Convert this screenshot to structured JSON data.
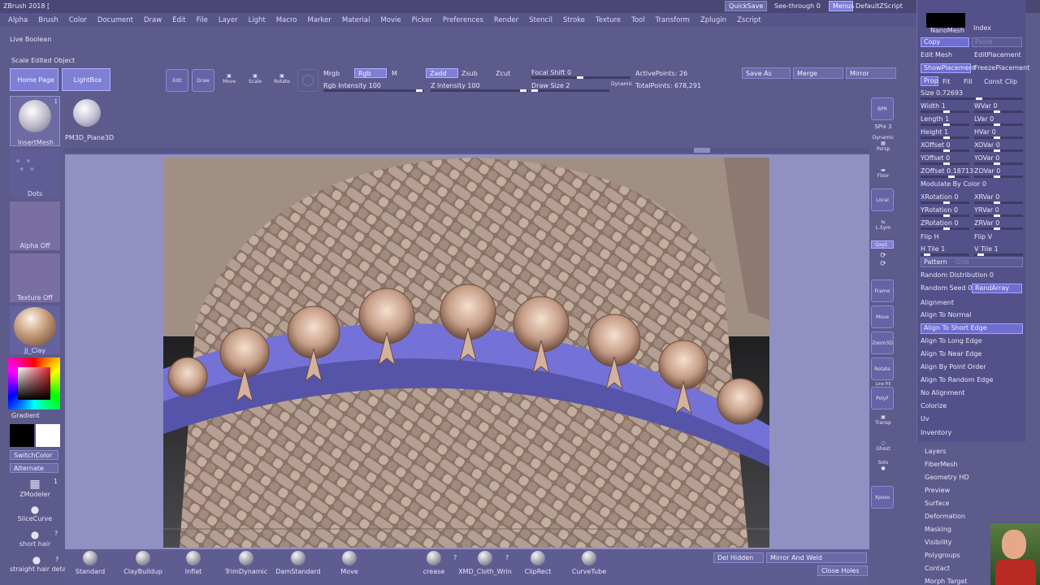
{
  "title": "ZBrush 2018 [",
  "top_right": {
    "quicksave": "QuickSave",
    "seethrough": "See-through 0",
    "menus": "Menus",
    "script": "DefaultZScript"
  },
  "menus": [
    "Alpha",
    "Brush",
    "Color",
    "Document",
    "Draw",
    "Edit",
    "File",
    "Layer",
    "Light",
    "Macro",
    "Marker",
    "Material",
    "Movie",
    "Picker",
    "Preferences",
    "Render",
    "Stencil",
    "Stroke",
    "Texture",
    "Tool",
    "Transform",
    "Zplugin",
    "Zscript"
  ],
  "left": {
    "live_boolean": "Live Boolean",
    "scale_edited": "Scale Edited Object",
    "home": "Home Page",
    "lightbox": "LightBox",
    "insertmesh": "InsertMesh",
    "insertmesh_count": "1",
    "pm3d": "PM3D_Plane3D",
    "dots": "Dots",
    "alpha_off": "Alpha Off",
    "texture_off": "Texture Off",
    "material": "Jj_Clay",
    "gradient": "Gradient",
    "switchcolor": "SwitchColor",
    "alternate": "Alternate",
    "zmodeler": "ZModeler",
    "zmodeler_count": "1",
    "slicecurve": "SliceCurve",
    "shorthair": "short hair",
    "shorthair_q": "?",
    "straighthair": "straight hair deta",
    "straighthair_q": "?"
  },
  "toolbar": {
    "edit": "Edit",
    "draw": "Draw",
    "move": "Move",
    "scale": "Scale",
    "rotate": "Rotate",
    "mrgb": "Mrgb",
    "rgb": "Rgb",
    "m": "M",
    "zadd": "Zadd",
    "zsub": "Zsub",
    "zcut": "Zcut",
    "rgb_intensity": "Rgb Intensity 100",
    "z_intensity": "Z Intensity 100",
    "focal_shift": "Focal Shift 0",
    "draw_size": "Draw Size 2",
    "dynamic": "Dynamic",
    "active_points": "ActivePoints: 26",
    "total_points": "TotalPoints: 678,291",
    "save_as": "Save As",
    "merge": "Merge",
    "mirror": "Mirror"
  },
  "right_shelf": {
    "bpr": "BPR",
    "spix": "SPix 3",
    "dynamic": "Dynamic",
    "persp": "Persp",
    "floor": "Floor",
    "local": "Local",
    "lsym": "L.Sym",
    "xyz": "Qxyz",
    "frame": "Frame",
    "move": "Move",
    "zoom3d": "Zoom3D",
    "rotate": "Rotate",
    "line_fill": "Line Fill",
    "polyf": "PolyF",
    "transp": "Transp",
    "ghost": "Ghost",
    "solo": "Solo",
    "xpose": "Xpose"
  },
  "right_panel": {
    "nanomesh": "NanoMesh",
    "index": "Index",
    "copy": "Copy",
    "paste": "Paste",
    "edit_mesh": "Edit Mesh",
    "edit_placement": "EditPlacement",
    "show_placement": "ShowPlacement",
    "freeze_placement": "FreezePlacement",
    "prop": "Prop",
    "fit": "Fit",
    "fill": "Fill",
    "const": "Const",
    "clip": "Clip",
    "size": "Size 0.72693",
    "width": "Width 1",
    "wvar": "WVar 0",
    "length": "Length 1",
    "lvar": "LVar 0",
    "height": "Height 1",
    "hvar": "HVar 0",
    "xoffset": "XOffset 0",
    "xovar": "XOVar 0",
    "yoffset": "YOffset 0",
    "yovar": "YOVar 0",
    "zoffset": "ZOffset 0.18713",
    "zovar": "ZOVar 0",
    "modulate": "Modulate By Color 0",
    "xrotation": "XRotation 0",
    "xrvar": "XRVar 0",
    "yrotation": "YRotation 0",
    "yrvar": "YRVar 0",
    "zrotation": "ZRotation 0",
    "zrvar": "ZRVar 0",
    "fliph": "Flip H",
    "flipv": "Flip V",
    "htile": "H Tile 1",
    "vtile": "V Tile 1",
    "pattern": "Pattern",
    "grid": "Grid",
    "random_dist": "Random Distribution 0",
    "random_seed": "Random Seed 0",
    "randarray": "RandArray",
    "alignment": "Alignment",
    "align_normal": "Align To Normal",
    "align_short": "Align To Short Edge",
    "align_long": "Align To Long Edge",
    "align_near": "Align To Near Edge",
    "align_point": "Align By Point Order",
    "align_random": "Align To Random Edge",
    "no_align": "No Alignment",
    "colorize": "Colorize",
    "uv": "Uv",
    "inventory": "Inventory",
    "subpalettes": [
      "Layers",
      "FiberMesh",
      "Geometry HD",
      "Preview",
      "Surface",
      "Deformation",
      "Masking",
      "Visibility",
      "Polygroups",
      "Contact",
      "Morph Target"
    ]
  },
  "bottom": {
    "brushes": [
      "Standard",
      "ClayBuildup",
      "Inflat",
      "TrimDynamic",
      "DamStandard",
      "Move",
      "crease",
      "XMD_Cloth_Wrin",
      "ClipRect",
      "CurveTube"
    ],
    "q1": "?",
    "q2": "?",
    "del_hidden": "Del Hidden",
    "mirror_weld": "Mirror And Weld",
    "close_holes": "Close Holes"
  }
}
